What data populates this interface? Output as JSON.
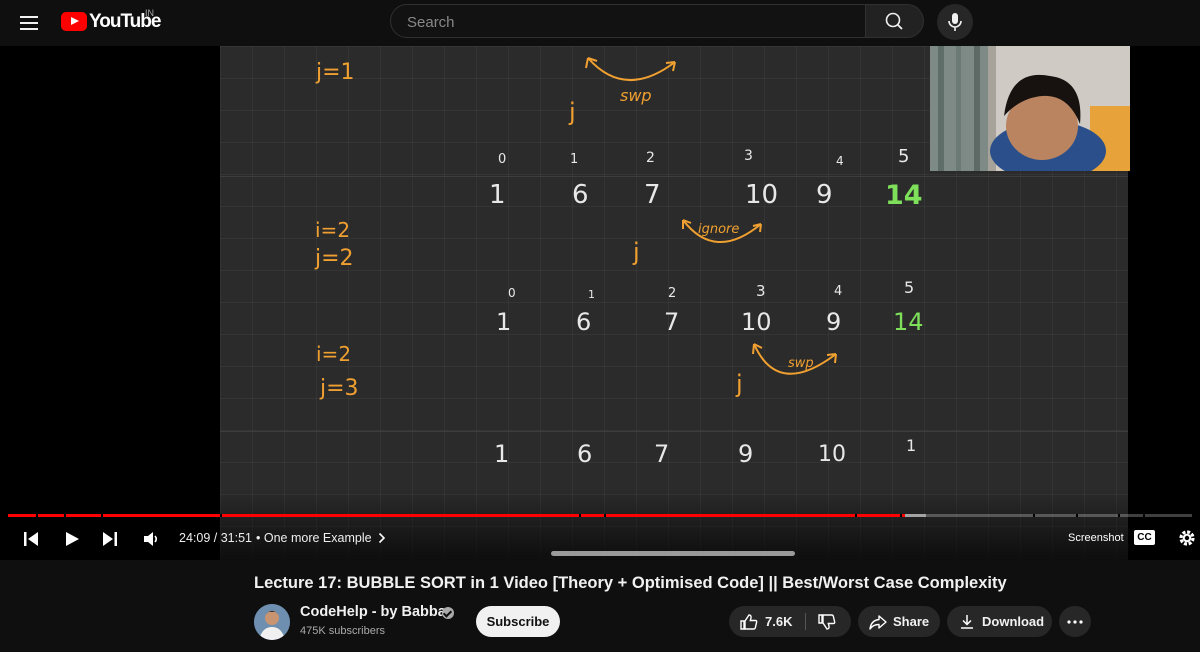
{
  "header": {
    "logo_text": "YouTube",
    "country_code": "IN",
    "search_placeholder": "Search"
  },
  "whiteboard": {
    "labels": [
      {
        "text": "j=1",
        "color": "orange"
      },
      {
        "text": "j",
        "color": "orange"
      },
      {
        "text": "swp",
        "color": "orange"
      },
      {
        "text": "i=2",
        "color": "orange"
      },
      {
        "text": "j=2",
        "color": "orange"
      },
      {
        "text": "j",
        "color": "orange"
      },
      {
        "text": "ignore",
        "color": "orange"
      },
      {
        "text": "i=2",
        "color": "orange"
      },
      {
        "text": "j=3",
        "color": "orange"
      },
      {
        "text": "j",
        "color": "orange"
      },
      {
        "text": "swp",
        "color": "orange"
      }
    ],
    "rows": [
      {
        "indices": [
          "0",
          "1",
          "2",
          "3",
          "4",
          "5"
        ],
        "values": [
          "1",
          "6",
          "7",
          "10",
          "9",
          "14"
        ]
      },
      {
        "indices": [
          "0",
          "1",
          "2",
          "3",
          "4",
          "5"
        ],
        "values": [
          "1",
          "6",
          "7",
          "10",
          "9",
          "14"
        ]
      },
      {
        "indices": [],
        "values": [
          "1",
          "6",
          "7",
          "9",
          "10",
          "1"
        ]
      }
    ]
  },
  "player": {
    "current_time": "24:09",
    "duration": "31:51",
    "time_display": "24:09 / 31:51",
    "chapter_separator": "•",
    "chapter_title": "One more Example",
    "screenshot_label": "Screenshot",
    "cc_label": "CC",
    "played_fraction": 0.758,
    "buffered_fraction": 0.775
  },
  "video_info": {
    "title": "Lecture 17: BUBBLE SORT in 1 Video [Theory + Optimised Code] || Best/Worst Case Complexity",
    "channel_name": "CodeHelp - by Babbar",
    "subscribers": "475K subscribers",
    "subscribe_label": "Subscribe",
    "likes": "7.6K",
    "share_label": "Share",
    "download_label": "Download"
  },
  "colors": {
    "brand_red": "#ff0000",
    "background": "#0f0f0f",
    "board": "#2b2b2b",
    "ink_orange": "#f0a030",
    "ink_white": "#e8e8e8",
    "ink_green": "#7ee05a"
  },
  "icons": [
    "menu-icon",
    "youtube-logo-icon",
    "search-icon",
    "mic-icon",
    "previous-icon",
    "play-icon",
    "next-icon",
    "volume-icon",
    "chevron-right-icon",
    "settings-gear-icon",
    "like-icon",
    "dislike-icon",
    "share-icon",
    "download-icon",
    "more-icon",
    "verified-icon"
  ]
}
